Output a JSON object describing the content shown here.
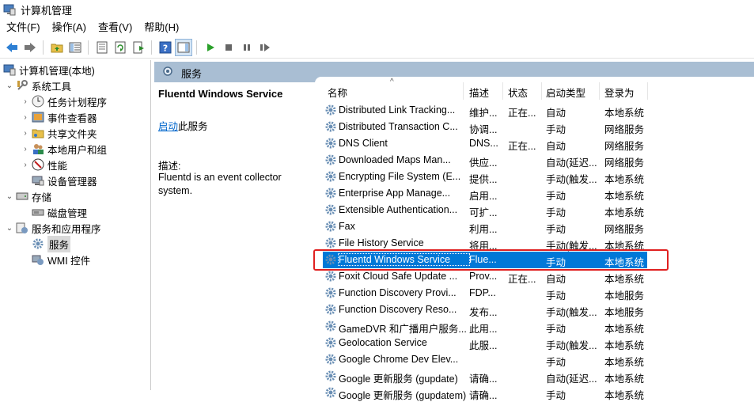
{
  "window": {
    "title": "计算机管理"
  },
  "menu": [
    "文件(F)",
    "操作(A)",
    "查看(V)",
    "帮助(H)"
  ],
  "tree": {
    "root": "计算机管理(本地)",
    "system_tools": "系统工具",
    "task_scheduler": "任务计划程序",
    "event_viewer": "事件查看器",
    "shared_folders": "共享文件夹",
    "local_users": "本地用户和组",
    "performance": "性能",
    "device_manager": "设备管理器",
    "storage": "存储",
    "disk_management": "磁盘管理",
    "services_apps": "服务和应用程序",
    "services": "服务",
    "wmi": "WMI 控件"
  },
  "header": {
    "label": "服务"
  },
  "details": {
    "service_name": "Fluentd Windows Service",
    "start_link": "启动",
    "start_suffix": "此服务",
    "desc_label": "描述:",
    "desc_text": "Fluentd is an event collector system."
  },
  "columns": [
    "名称",
    "描述",
    "状态",
    "启动类型",
    "登录为"
  ],
  "services": [
    {
      "name": "Distributed Link Tracking...",
      "desc": "维护...",
      "status": "正在...",
      "startup": "自动",
      "logon": "本地系统"
    },
    {
      "name": "Distributed Transaction C...",
      "desc": "协调...",
      "status": "",
      "startup": "手动",
      "logon": "网络服务"
    },
    {
      "name": "DNS Client",
      "desc": "DNS...",
      "status": "正在...",
      "startup": "自动",
      "logon": "网络服务"
    },
    {
      "name": "Downloaded Maps Man...",
      "desc": "供应...",
      "status": "",
      "startup": "自动(延迟...",
      "logon": "网络服务"
    },
    {
      "name": "Encrypting File System (E...",
      "desc": "提供...",
      "status": "",
      "startup": "手动(触发...",
      "logon": "本地系统"
    },
    {
      "name": "Enterprise App Manage...",
      "desc": "启用...",
      "status": "",
      "startup": "手动",
      "logon": "本地系统"
    },
    {
      "name": "Extensible Authentication...",
      "desc": "可扩...",
      "status": "",
      "startup": "手动",
      "logon": "本地系统"
    },
    {
      "name": "Fax",
      "desc": "利用...",
      "status": "",
      "startup": "手动",
      "logon": "网络服务"
    },
    {
      "name": "File History Service",
      "desc": "将用...",
      "status": "",
      "startup": "手动(触发...",
      "logon": "本地系统"
    },
    {
      "name": "Fluentd Windows Service",
      "desc": "Flue...",
      "status": "",
      "startup": "手动",
      "logon": "本地系统"
    },
    {
      "name": "Foxit Cloud Safe Update ...",
      "desc": "Prov...",
      "status": "正在...",
      "startup": "自动",
      "logon": "本地系统"
    },
    {
      "name": "Function Discovery Provi...",
      "desc": "FDP...",
      "status": "",
      "startup": "手动",
      "logon": "本地服务"
    },
    {
      "name": "Function Discovery Reso...",
      "desc": "发布...",
      "status": "",
      "startup": "手动(触发...",
      "logon": "本地服务"
    },
    {
      "name": "GameDVR 和广播用户服务...",
      "desc": "此用...",
      "status": "",
      "startup": "手动",
      "logon": "本地系统"
    },
    {
      "name": "Geolocation Service",
      "desc": "此服...",
      "status": "",
      "startup": "手动(触发...",
      "logon": "本地系统"
    },
    {
      "name": "Google Chrome Dev Elev...",
      "desc": "",
      "status": "",
      "startup": "手动",
      "logon": "本地系统"
    },
    {
      "name": "Google 更新服务 (gupdate)",
      "desc": "请确...",
      "status": "",
      "startup": "自动(延迟...",
      "logon": "本地系统"
    },
    {
      "name": "Google 更新服务 (gupdatem)",
      "desc": "请确...",
      "status": "",
      "startup": "手动",
      "logon": "本地系统"
    }
  ],
  "selected_index": 9
}
